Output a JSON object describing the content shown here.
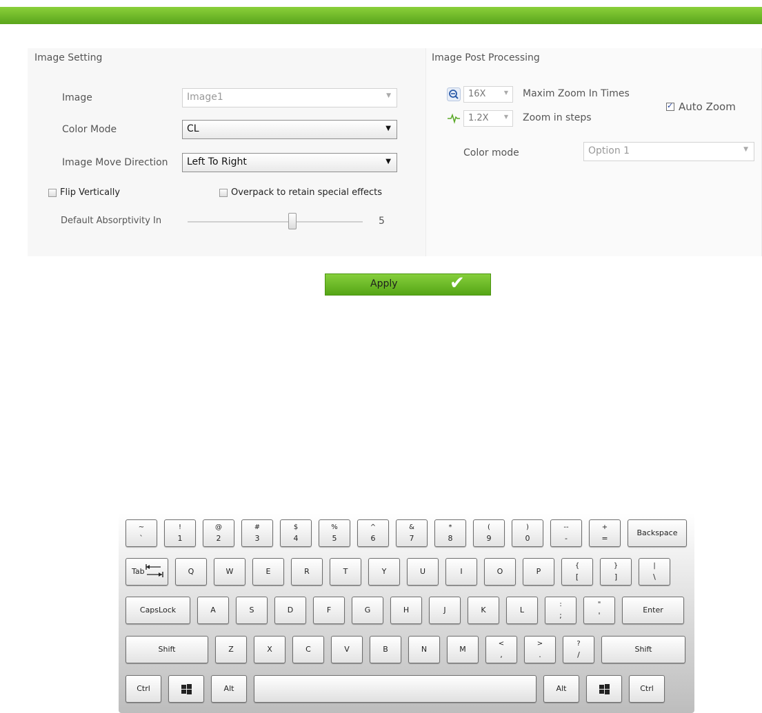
{
  "image_setting": {
    "title": "Image Setting",
    "image": {
      "label": "Image",
      "value": "Image1"
    },
    "color_mode": {
      "label": "Color Mode",
      "value": "CL"
    },
    "move_direction": {
      "label": "Image Move Direction",
      "value": "Left To Right"
    },
    "flip_vertically": {
      "label": "Flip Vertically",
      "checked": false
    },
    "overpack": {
      "label": "Overpack to retain special effects",
      "checked": false
    },
    "absorptivity": {
      "label": "Default Absorptivity In",
      "value": "5"
    }
  },
  "post_processing": {
    "title": "Image Post Processing",
    "max_zoom": {
      "value": "16X",
      "label": "Maxim Zoom In Times",
      "icon": "zoom-out-icon"
    },
    "zoom_steps": {
      "value": "1.2X",
      "label": "Zoom in steps",
      "icon": "pulse-icon"
    },
    "auto_zoom": {
      "label": "Auto Zoom",
      "checked": true
    },
    "color_mode": {
      "label": "Color mode",
      "value": "Option 1"
    }
  },
  "apply_button": {
    "label": "Apply",
    "icon": "checkmark-icon"
  },
  "colors": {
    "accent_green": "#6bbd28",
    "icon_blue": "#2a5aa8"
  },
  "keyboard": {
    "row1": [
      {
        "top": "~",
        "bot": "`"
      },
      {
        "top": "!",
        "bot": "1"
      },
      {
        "top": "@",
        "bot": "2"
      },
      {
        "top": "#",
        "bot": "3"
      },
      {
        "top": "$",
        "bot": "4"
      },
      {
        "top": "%",
        "bot": "5"
      },
      {
        "top": "^",
        "bot": "6"
      },
      {
        "top": "&",
        "bot": "7"
      },
      {
        "top": "*",
        "bot": "8"
      },
      {
        "top": "(",
        "bot": "9"
      },
      {
        "top": ")",
        "bot": "0"
      },
      {
        "top": "--",
        "bot": "-"
      },
      {
        "top": "+",
        "bot": "="
      },
      {
        "label": "Backspace"
      }
    ],
    "row2": [
      {
        "label": "Tab"
      },
      {
        "label": "Q"
      },
      {
        "label": "W"
      },
      {
        "label": "E"
      },
      {
        "label": "R"
      },
      {
        "label": "T"
      },
      {
        "label": "Y"
      },
      {
        "label": "U"
      },
      {
        "label": "I"
      },
      {
        "label": "O"
      },
      {
        "label": "P"
      },
      {
        "top": "{",
        "bot": "["
      },
      {
        "top": "}",
        "bot": "]"
      },
      {
        "top": "|",
        "bot": "\\"
      }
    ],
    "row3": [
      {
        "label": "CapsLock"
      },
      {
        "label": "A"
      },
      {
        "label": "S"
      },
      {
        "label": "D"
      },
      {
        "label": "F"
      },
      {
        "label": "G"
      },
      {
        "label": "H"
      },
      {
        "label": "J"
      },
      {
        "label": "K"
      },
      {
        "label": "L"
      },
      {
        "top": ":",
        "bot": ";"
      },
      {
        "top": "\"",
        "bot": "'"
      },
      {
        "label": "Enter"
      }
    ],
    "row4": [
      {
        "label": "Shift"
      },
      {
        "label": "Z"
      },
      {
        "label": "X"
      },
      {
        "label": "C"
      },
      {
        "label": "V"
      },
      {
        "label": "B"
      },
      {
        "label": "N"
      },
      {
        "label": "M"
      },
      {
        "top": "<",
        "bot": ","
      },
      {
        "top": ">",
        "bot": "."
      },
      {
        "top": "?",
        "bot": "/"
      },
      {
        "label": "Shift"
      }
    ],
    "row5": [
      {
        "label": "Ctrl"
      },
      {
        "icon": "windows-icon"
      },
      {
        "label": "Alt"
      },
      {
        "label": ""
      },
      {
        "label": "Alt"
      },
      {
        "icon": "windows-icon"
      },
      {
        "label": "Ctrl"
      }
    ]
  }
}
